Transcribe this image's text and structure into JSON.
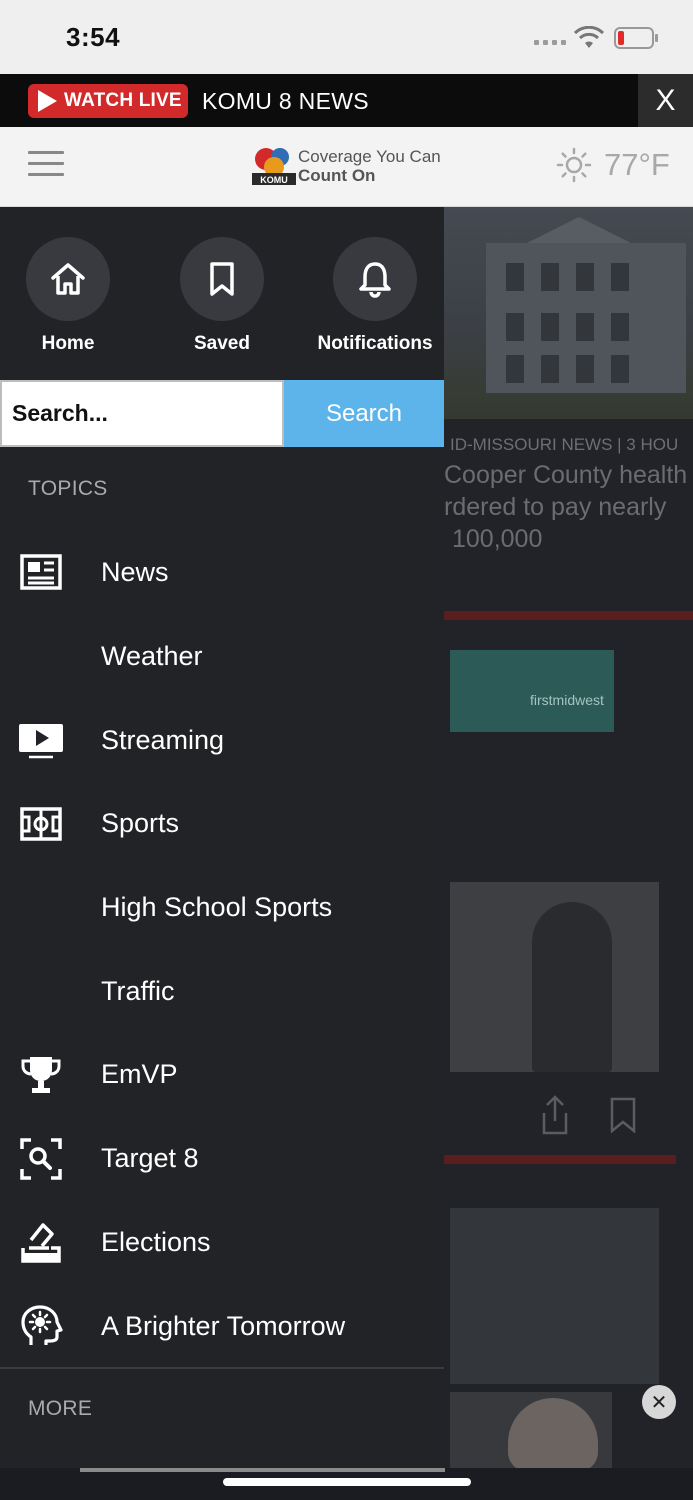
{
  "status_bar": {
    "time": "3:54"
  },
  "live_banner": {
    "watch_label": "WATCH LIVE",
    "title": "KOMU 8 NEWS",
    "close_label": "X"
  },
  "header": {
    "logo_line1": "Coverage You Can",
    "logo_line2": "Count On",
    "logo_mark_text": "KOMU",
    "temperature": "77°F",
    "weather_icon": "sun-icon"
  },
  "drawer": {
    "quick_links": [
      {
        "label": "Home",
        "icon": "home-icon"
      },
      {
        "label": "Saved",
        "icon": "bookmark-icon"
      },
      {
        "label": "Notifications",
        "icon": "bell-icon"
      }
    ],
    "search": {
      "placeholder": "Search...",
      "button_label": "Search"
    },
    "topics_label": "TOPICS",
    "topics": [
      {
        "label": "News",
        "icon": "newspaper-icon"
      },
      {
        "label": "Weather",
        "icon": ""
      },
      {
        "label": "Streaming",
        "icon": "play-tv-icon"
      },
      {
        "label": "Sports",
        "icon": "field-icon"
      },
      {
        "label": "High School Sports",
        "icon": ""
      },
      {
        "label": "Traffic",
        "icon": ""
      },
      {
        "label": "EmVP",
        "icon": "trophy-icon"
      },
      {
        "label": "Target 8",
        "icon": "magnify-scan-icon"
      },
      {
        "label": "Elections",
        "icon": "ballot-box-icon"
      },
      {
        "label": "A Brighter Tomorrow",
        "icon": "head-idea-icon"
      }
    ],
    "more_label": "MORE"
  },
  "background": {
    "story_meta": "ID-MISSOURI NEWS | 3 HOU",
    "story_headline_lines": [
      "Cooper County health",
      "rdered to pay nearly",
      "100,000"
    ],
    "ad_text": "firstmidwest"
  },
  "colors": {
    "live_red": "#d22a2a",
    "search_blue": "#5cb4ea",
    "drawer_bg": "#222327"
  }
}
